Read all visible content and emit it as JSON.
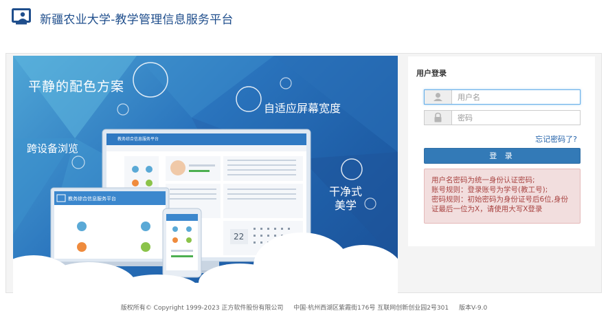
{
  "header": {
    "title": "新疆农业大学-教学管理信息服务平台"
  },
  "banner": {
    "slogan_1": "平静的配色方案",
    "slogan_2": "自适应屏幕宽度",
    "slogan_3": "跨设备浏览",
    "slogan_4a": "干净式",
    "slogan_4b": "美学",
    "mock_title_desktop": "教务综合信息服务平台",
    "mock_title_laptop": "教务综合信息服务平台",
    "mock_calendar_day": "22"
  },
  "login": {
    "title": "用户登录",
    "username_placeholder": "用户名",
    "password_placeholder": "密码",
    "forgot_link": "忘记密码了?",
    "submit_label": "登 录",
    "notice": [
      "用户名密码为统一身份认证密码;",
      "账号规则：登录账号为学号(教工号);",
      "密码规则：初始密码为身份证号后6位,身份",
      "证最后一位为X，请使用大写X登录"
    ]
  },
  "footer": {
    "copyright": "版权所有© Copyright 1999-2023 正方软件股份有限公司",
    "address": "中国·杭州西湖区紫霞街176号 互联网创新创业园2号301",
    "version": "版本V-9.0"
  },
  "colors": {
    "brand": "#1f4e8c",
    "button": "#337ab7",
    "alert_bg": "#f2dede",
    "alert_text": "#a94442"
  }
}
